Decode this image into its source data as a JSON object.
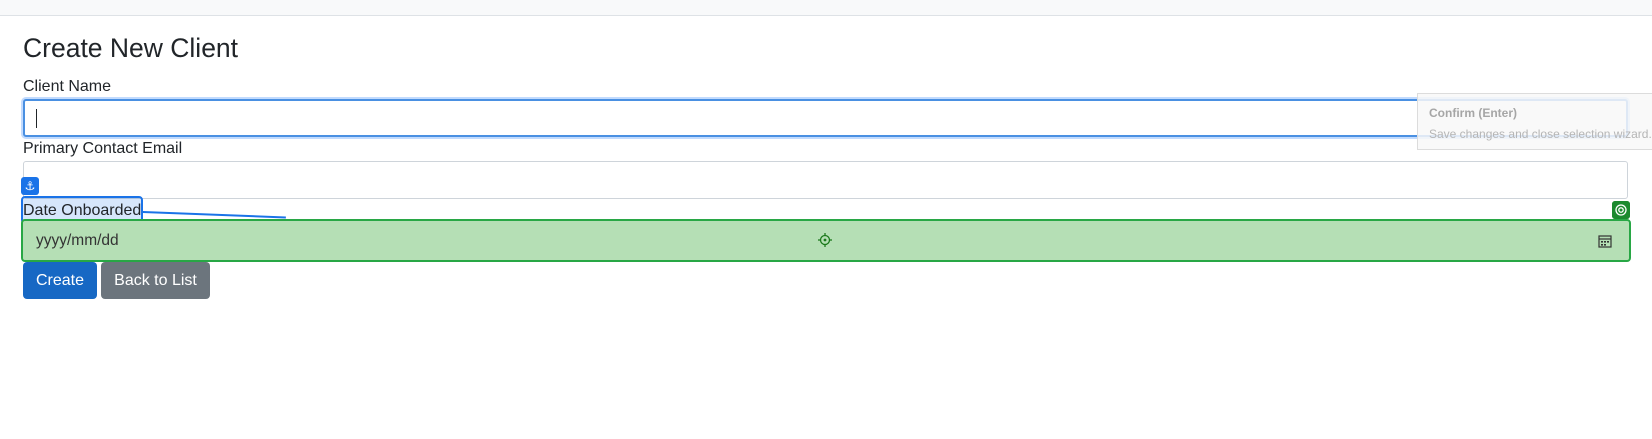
{
  "page": {
    "title": "Create New Client"
  },
  "form": {
    "client_name_label": "Client Name",
    "client_name_value": "",
    "email_label": "Primary Contact Email",
    "email_value": "",
    "date_label": "Date Onboarded",
    "date_placeholder": "yyyy/mm/dd"
  },
  "buttons": {
    "create_label": "Create",
    "back_label": "Back to List"
  },
  "tooltip": {
    "title": "Confirm (Enter)",
    "description": "Save changes and close selection wizard."
  },
  "colors": {
    "focus_border": "#4a90e2",
    "anchor_blue": "#1a73e8",
    "target_green": "#28a745",
    "target_fill": "#b5dfb5",
    "primary_button": "#1768c4",
    "secondary_button": "#6c757d"
  },
  "icons": {
    "anchor": "anchor-icon",
    "crosshair": "crosshair-icon",
    "calendar": "calendar-icon",
    "target": "target-icon"
  }
}
